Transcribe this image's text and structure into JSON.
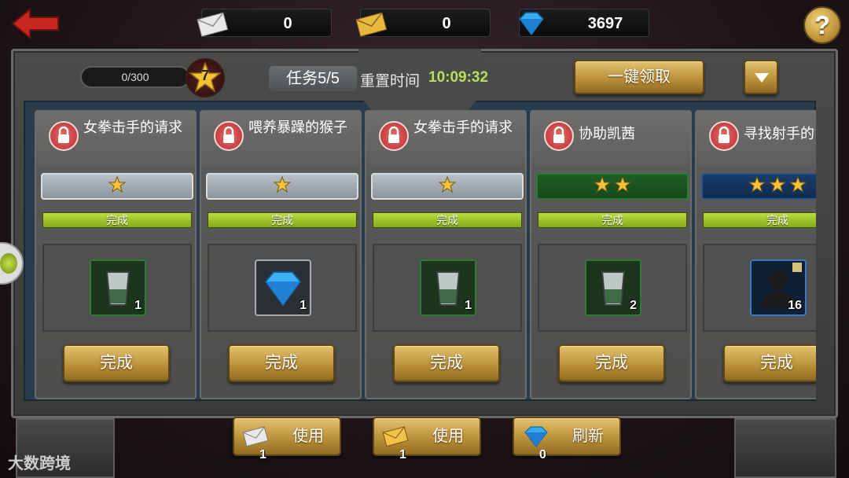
{
  "header": {
    "envelope_white_count": "0",
    "envelope_gold_count": "0",
    "gem_count": "3697",
    "help_label": "?"
  },
  "progress": {
    "xp_text": "0/300",
    "level": "7",
    "task_count": "任务5/5",
    "reset_label": "重置时间",
    "reset_time": "10:09:32"
  },
  "actions": {
    "claim_all_label": "一键领取"
  },
  "cards": [
    {
      "title": "女拳击手的请求",
      "stars": 1,
      "tier": "grey",
      "status": "完成",
      "reward": "potion",
      "qty": "1",
      "button": "完成"
    },
    {
      "title": "喂养暴躁的猴子",
      "stars": 1,
      "tier": "grey",
      "status": "完成",
      "reward": "gem",
      "qty": "1",
      "button": "完成"
    },
    {
      "title": "女拳击手的请求",
      "stars": 1,
      "tier": "grey",
      "status": "完成",
      "reward": "potion",
      "qty": "1",
      "button": "完成"
    },
    {
      "title": "协助凯茜",
      "stars": 2,
      "tier": "green",
      "status": "完成",
      "reward": "potion",
      "qty": "2",
      "button": "完成"
    },
    {
      "title": "寻找射手的",
      "stars": 3,
      "tier": "blue",
      "status": "完成",
      "reward": "hero",
      "qty": "16",
      "button": "完成"
    }
  ],
  "footer": {
    "use_white": {
      "count": "1",
      "label": "使用"
    },
    "use_gold": {
      "count": "1",
      "label": "使用"
    },
    "refresh": {
      "count": "0",
      "label": "刷新"
    },
    "watermark": "大数跨境"
  },
  "colors": {
    "gold_button": "#b88d37",
    "timer_green": "#b6e05a",
    "done_bar": "#a6c92f",
    "panel_blue": "#2b3c4c"
  }
}
